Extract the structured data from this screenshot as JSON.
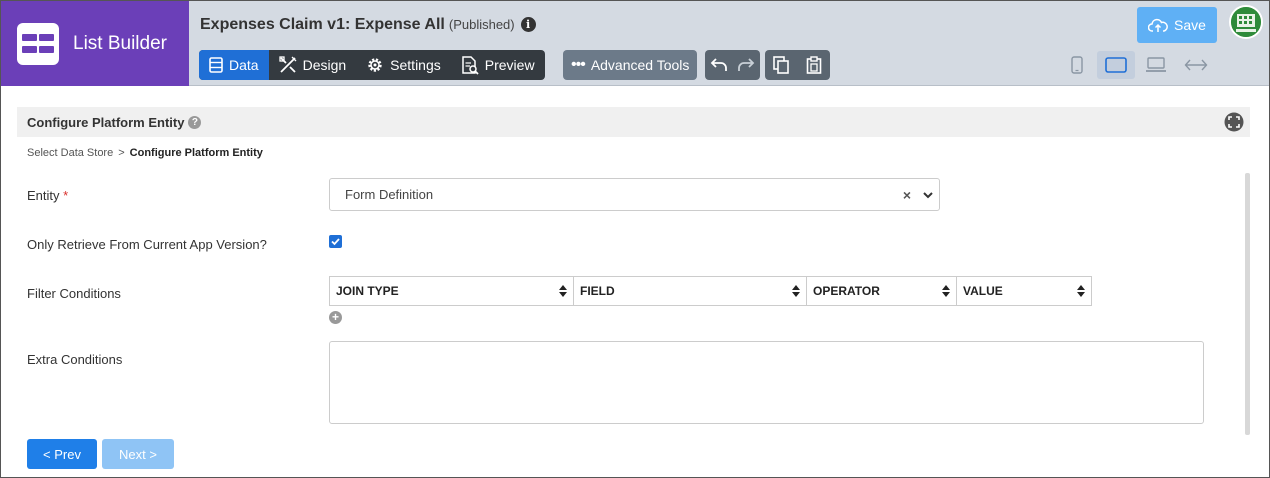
{
  "brand": {
    "title": "List Builder",
    "icon": "list-grid-icon"
  },
  "header": {
    "title": "Expenses Claim v1: Expense All",
    "status": "(Published)",
    "info_icon": "info-icon",
    "info_glyph": "i"
  },
  "tabs": [
    {
      "label": "Data",
      "icon": "data-list-icon",
      "active": true
    },
    {
      "label": "Design",
      "icon": "design-tools-icon",
      "active": false
    },
    {
      "label": "Settings",
      "icon": "gear-icon",
      "active": false
    },
    {
      "label": "Preview",
      "icon": "preview-document-icon",
      "active": false
    }
  ],
  "toolbar": {
    "advanced_tools_label": "Advanced Tools",
    "advanced_tools_glyph": "•••",
    "save_label": "Save"
  },
  "section": {
    "title": "Configure Platform Entity",
    "help_glyph": "?"
  },
  "breadcrumb": {
    "parent": "Select Data Store",
    "separator": ">",
    "current": "Configure Platform Entity"
  },
  "form": {
    "entity_label": "Entity",
    "required_mark": "*",
    "entity_value": "Form Definition",
    "clear_glyph": "×",
    "version_label": "Only Retrieve From Current App Version?",
    "version_checked": true,
    "filter_label": "Filter Conditions",
    "filter_columns": [
      "JOIN TYPE",
      "FIELD",
      "OPERATOR",
      "VALUE"
    ],
    "add_glyph": "+",
    "extra_label": "Extra Conditions",
    "extra_value": ""
  },
  "nav": {
    "prev_label": "< Prev",
    "next_label": "Next >"
  },
  "colors": {
    "brand": "#6b3fb8",
    "primary": "#1f6fd6",
    "save": "#5fb0f5",
    "toolbar_dark": "#343a40"
  }
}
